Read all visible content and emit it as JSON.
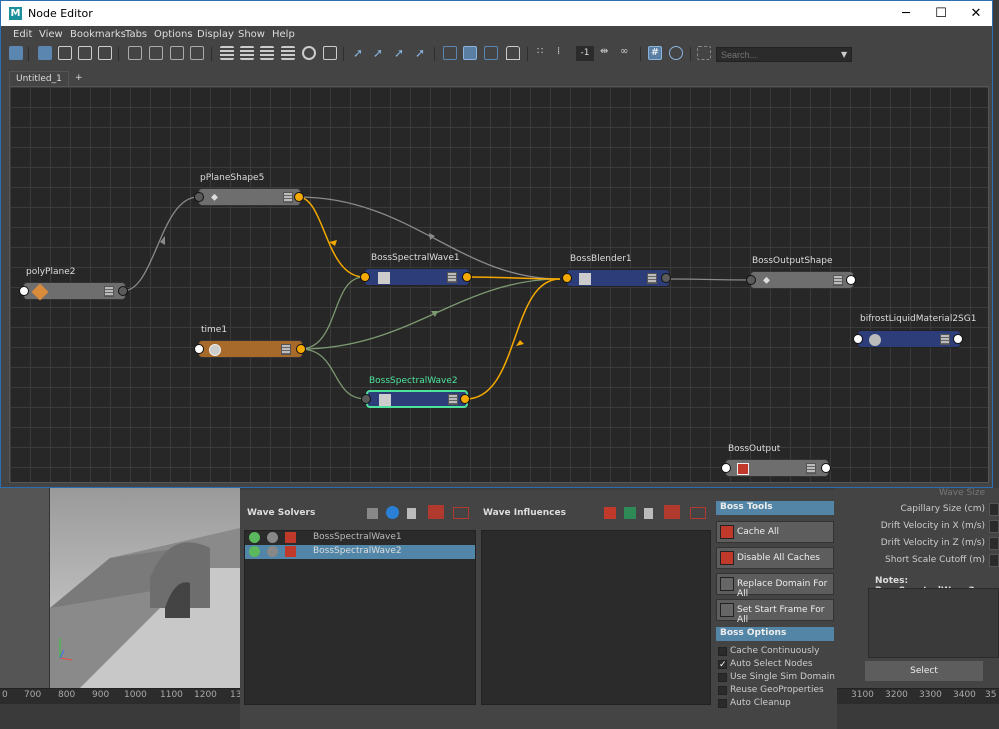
{
  "window": {
    "title": "Node Editor",
    "minimize": "─",
    "maximize": "☐",
    "close": "✕",
    "app_icon": "M"
  },
  "menu": [
    "Edit",
    "View",
    "Bookmarks",
    "Tabs",
    "Options",
    "Display",
    "Show",
    "Help"
  ],
  "toolbar": {
    "search_placeholder": "Search...",
    "field_value": "-1"
  },
  "tabs": {
    "current": "Untitled_1",
    "add": "+"
  },
  "nodes": {
    "polyPlane2": "polyPlane2",
    "pPlaneShape5": "pPlaneShape5",
    "time1": "time1",
    "bossSpectralWave1": "BossSpectralWave1",
    "bossSpectralWave2": "BossSpectralWave2",
    "bossBlender1": "BossBlender1",
    "bossOutputShape": "BossOutputShape",
    "bifrostMaterial": "bifrostLiquidMaterial2SG1",
    "bossOutput": "BossOutput"
  },
  "boss_panel": {
    "wave_solvers_title": "Wave Solvers",
    "wave_influences_title": "Wave Influences",
    "solvers": [
      {
        "name": "BossSpectralWave1",
        "selected": false
      },
      {
        "name": "BossSpectralWave2",
        "selected": true
      }
    ],
    "boss_tools_title": "Boss Tools",
    "tools": [
      "Cache All",
      "Disable All Caches",
      "Replace Domain For All",
      "Set Start Frame For All"
    ],
    "boss_options_title": "Boss Options",
    "options": [
      {
        "label": "Cache Continuously",
        "checked": false
      },
      {
        "label": "Auto Select Nodes",
        "checked": true
      },
      {
        "label": "Use Single Sim Domain",
        "checked": false
      },
      {
        "label": "Reuse GeoProperties",
        "checked": false
      },
      {
        "label": "Auto Cleanup",
        "checked": false
      }
    ]
  },
  "right_panel": {
    "wave_size": "Wave Size",
    "capillary_size": "Capillary Size (cm)",
    "drift_x": "Drift Velocity in X (m/s)",
    "drift_z": "Drift Velocity in Z (m/s)",
    "short_scale": "Short Scale Cutoff (m)",
    "notes": "Notes:  BossSpectralWave2",
    "select_button": "Select"
  },
  "timeline": {
    "left_ticks": [
      "0",
      "700",
      "800",
      "900",
      "1000",
      "1100",
      "1200",
      "13"
    ],
    "right_ticks": [
      "3100",
      "3200",
      "3300",
      "3400",
      "35"
    ]
  },
  "colors": {
    "accent_blue": "#5286a8",
    "wave_node_blue": "#2c3d7a",
    "time_node_orange": "#a86a2a",
    "connection_yellow": "#f5a900",
    "selected_outline": "#4ee39c"
  }
}
